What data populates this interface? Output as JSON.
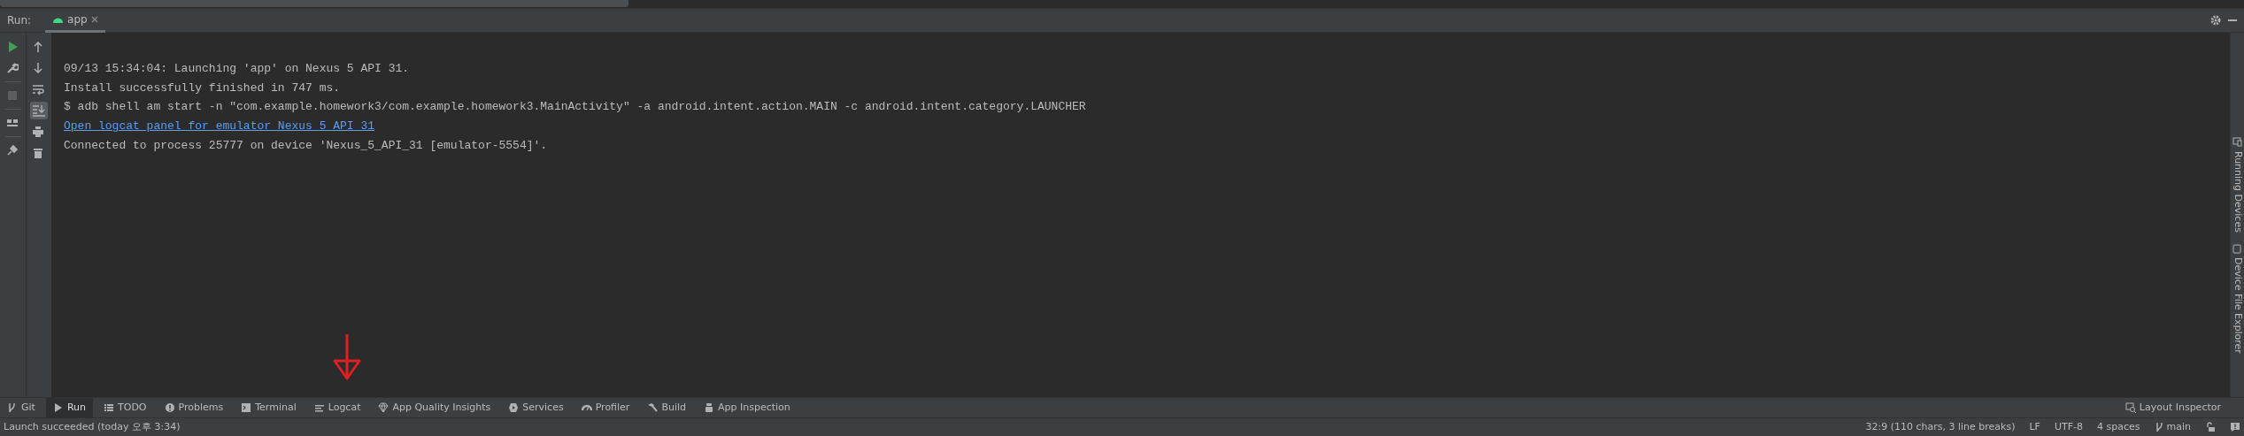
{
  "run_panel": {
    "label": "Run:",
    "tabs": [
      {
        "label": "app",
        "selected": true
      }
    ]
  },
  "console_toolbar": {
    "scroll_to_end_on": true,
    "stop_disabled": true
  },
  "console": {
    "lines": [
      {
        "kind": "text",
        "text": "09/13 15:34:04: Launching 'app' on Nexus 5 API 31."
      },
      {
        "kind": "text",
        "text": "Install successfully finished in 747 ms."
      },
      {
        "kind": "text",
        "text": "$ adb shell am start -n \"com.example.homework3/com.example.homework3.MainActivity\" -a android.intent.action.MAIN -c android.intent.category.LAUNCHER"
      },
      {
        "kind": "link",
        "text": "Open logcat panel for emulator Nexus 5 API 31"
      },
      {
        "kind": "text",
        "text": "Connected to process 25777 on device 'Nexus_5_API_31 [emulator-5554]'."
      }
    ]
  },
  "side_tabs": [
    {
      "label": "Running Devices"
    },
    {
      "label": "Device File Explorer"
    }
  ],
  "tool_tabs": [
    {
      "label": "Git",
      "selected": false
    },
    {
      "label": "Run",
      "selected": true
    },
    {
      "label": "TODO",
      "selected": false
    },
    {
      "label": "Problems",
      "selected": false
    },
    {
      "label": "Terminal",
      "selected": false
    },
    {
      "label": "Logcat",
      "selected": false
    },
    {
      "label": "App Quality Insights",
      "selected": false
    },
    {
      "label": "Services",
      "selected": false
    },
    {
      "label": "Profiler",
      "selected": false
    },
    {
      "label": "Build",
      "selected": false
    },
    {
      "label": "App Inspection",
      "selected": false
    }
  ],
  "right_tool_tabs": [
    {
      "label": "Layout Inspector"
    }
  ],
  "status_bar": {
    "message": "Launch succeeded (today 오후 3:34)",
    "items": [
      "32:9 (110 chars, 3 line breaks)",
      "LF",
      "UTF-8",
      "4 spaces"
    ],
    "branch": "main"
  }
}
